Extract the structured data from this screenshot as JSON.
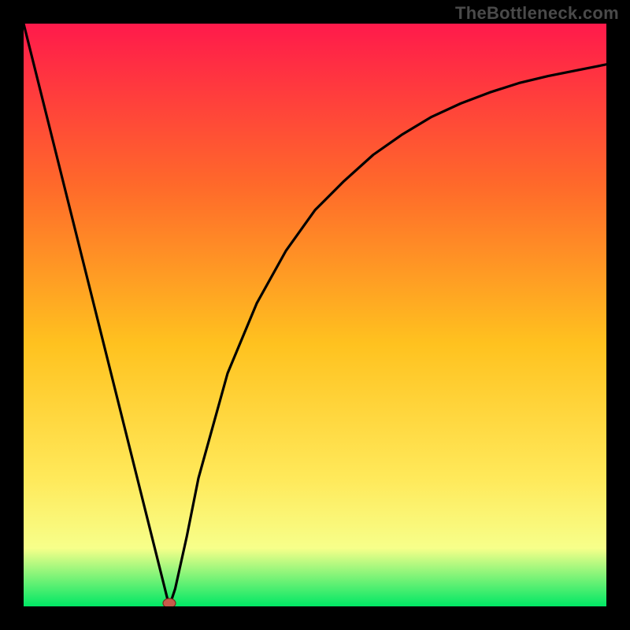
{
  "watermark": "TheBottleneck.com",
  "colors": {
    "frame": "#000000",
    "gradient_top": "#ff1a4b",
    "gradient_mid1": "#ff6a2a",
    "gradient_mid2": "#ffc21f",
    "gradient_mid3": "#ffe95a",
    "gradient_mid4": "#f7ff8a",
    "gradient_bottom": "#00e765",
    "curve": "#000000",
    "marker_fill": "#c85a4a",
    "marker_stroke": "#7a2d20"
  },
  "chart_data": {
    "type": "line",
    "title": "",
    "xlabel": "",
    "ylabel": "",
    "xlim": [
      0,
      100
    ],
    "ylim": [
      0,
      100
    ],
    "grid": false,
    "series": [
      {
        "name": "bottleneck-curve",
        "x": [
          0,
          5,
          10,
          15,
          20,
          22,
          24,
          25,
          26,
          28,
          30,
          35,
          40,
          45,
          50,
          55,
          60,
          65,
          70,
          75,
          80,
          85,
          90,
          95,
          100
        ],
        "y": [
          100,
          80,
          60,
          40,
          20,
          12,
          4,
          0,
          3,
          12,
          22,
          40,
          52,
          61,
          68,
          73,
          77.5,
          81,
          84,
          86.3,
          88.2,
          89.8,
          91,
          92,
          93
        ]
      }
    ],
    "marker": {
      "x": 25,
      "y": 0
    }
  }
}
